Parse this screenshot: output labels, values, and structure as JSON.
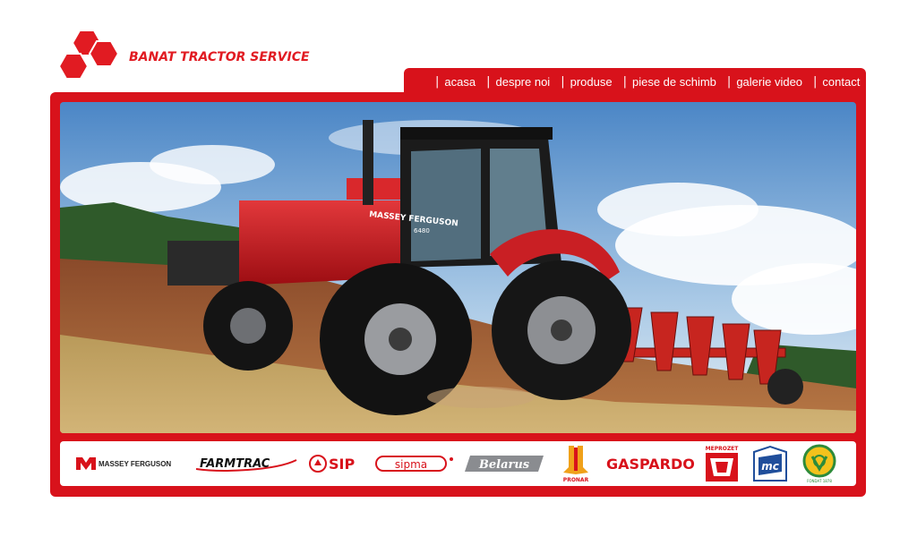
{
  "brand": {
    "name": "BANAT TRACTOR SERVICE",
    "color": "#e11b22"
  },
  "nav": {
    "separator": "|",
    "items": [
      {
        "label": "acasa"
      },
      {
        "label": "despre noi"
      },
      {
        "label": "produse"
      },
      {
        "label": "piese de schimb"
      },
      {
        "label": "galerie video"
      },
      {
        "label": "contact"
      }
    ]
  },
  "hero": {
    "tractor_model": "MASSEY FERGUSON",
    "tractor_number": "6480"
  },
  "partners": [
    {
      "name": "MASSEY FERGUSON",
      "icon": "massey-ferguson-logo"
    },
    {
      "name": "FARMTRAC",
      "icon": "farmtrac-logo"
    },
    {
      "name": "SIP",
      "icon": "sip-logo"
    },
    {
      "name": "sipma",
      "icon": "sipma-logo"
    },
    {
      "name": "Belarus",
      "icon": "belarus-logo"
    },
    {
      "name": "PRONAR",
      "icon": "pronar-logo"
    },
    {
      "name": "GASPARDO",
      "icon": "gaspardo-logo"
    },
    {
      "name": "MEPROZET",
      "icon": "meprozet-logo"
    },
    {
      "name": "mc",
      "icon": "mc-logo"
    },
    {
      "name": "FONDAT 1878",
      "icon": "vogel-logo"
    }
  ],
  "colors": {
    "primary_red": "#d8121b",
    "white": "#ffffff"
  }
}
